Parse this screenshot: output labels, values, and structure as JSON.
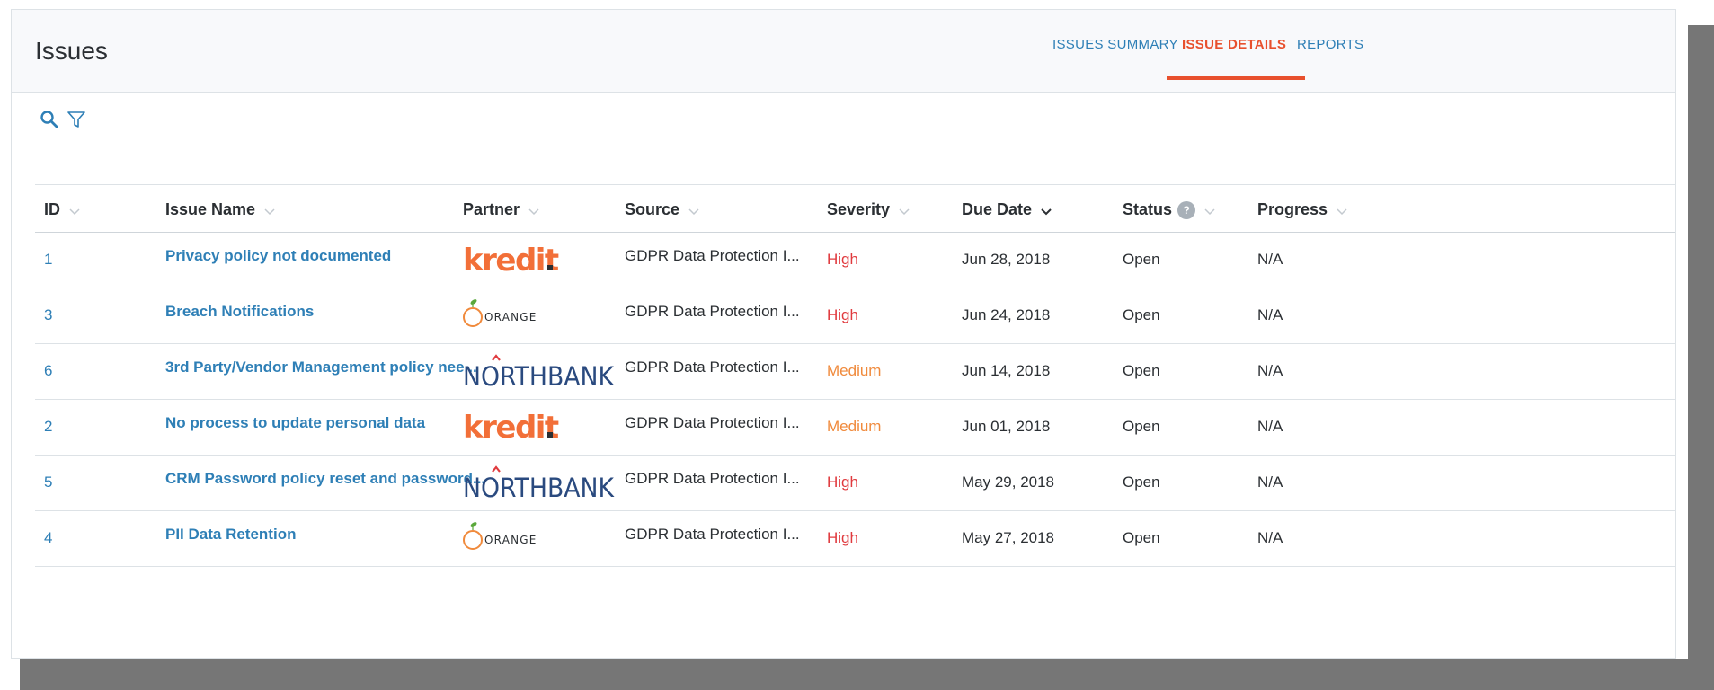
{
  "header": {
    "title": "Issues"
  },
  "tabs": [
    {
      "label": "ISSUES SUMMARY",
      "active": false
    },
    {
      "label": "ISSUE DETAILS",
      "active": true
    },
    {
      "label": "REPORTS",
      "active": false
    }
  ],
  "toolbar": {
    "icons": [
      "search-icon",
      "filter-icon"
    ]
  },
  "columns": [
    {
      "label": "ID",
      "sort": "none"
    },
    {
      "label": "Issue Name",
      "sort": "none"
    },
    {
      "label": "Partner",
      "sort": "none"
    },
    {
      "label": "Source",
      "sort": "none"
    },
    {
      "label": "Severity",
      "sort": "none"
    },
    {
      "label": "Due Date",
      "sort": "descending"
    },
    {
      "label": "Status",
      "sort": "none",
      "help": "?"
    },
    {
      "label": "Progress",
      "sort": "none"
    }
  ],
  "rows": [
    {
      "id": "1",
      "name": "Privacy policy not documented",
      "partner": "kredit.",
      "source": "GDPR Data Protection I...",
      "severity": "High",
      "due": "Jun 28, 2018",
      "status": "Open",
      "progress": "N/A"
    },
    {
      "id": "3",
      "name": "Breach Notifications",
      "partner": "ORANGE",
      "source": "GDPR Data Protection I...",
      "severity": "High",
      "due": "Jun 24, 2018",
      "status": "Open",
      "progress": "N/A"
    },
    {
      "id": "6",
      "name": "3rd Party/Vendor Management policy nee...",
      "partner": "NORTHBANK",
      "source": "GDPR Data Protection I...",
      "severity": "Medium",
      "due": "Jun 14, 2018",
      "status": "Open",
      "progress": "N/A"
    },
    {
      "id": "2",
      "name": "No process to update personal data",
      "partner": "kredit.",
      "source": "GDPR Data Protection I...",
      "severity": "Medium",
      "due": "Jun 01, 2018",
      "status": "Open",
      "progress": "N/A"
    },
    {
      "id": "5",
      "name": "CRM Password policy reset and password...",
      "partner": "NORTHBANK",
      "source": "GDPR Data Protection I...",
      "severity": "High",
      "due": "May 29, 2018",
      "status": "Open",
      "progress": "N/A"
    },
    {
      "id": "4",
      "name": "PII Data Retention",
      "partner": "ORANGE",
      "source": "GDPR Data Protection I...",
      "severity": "High",
      "due": "May 27, 2018",
      "status": "Open",
      "progress": "N/A"
    }
  ],
  "colors": {
    "link": "#2e7fb6",
    "accent": "#e8502d",
    "severity_high": "#e03a3e",
    "severity_medium": "#f08a3c",
    "kredit": "#f26f38",
    "northbank": "#2a4a7f",
    "northbank_dot": "#e03a3e",
    "orange_fruit": "#f08a3c",
    "orange_leaf": "#5aa83b"
  }
}
